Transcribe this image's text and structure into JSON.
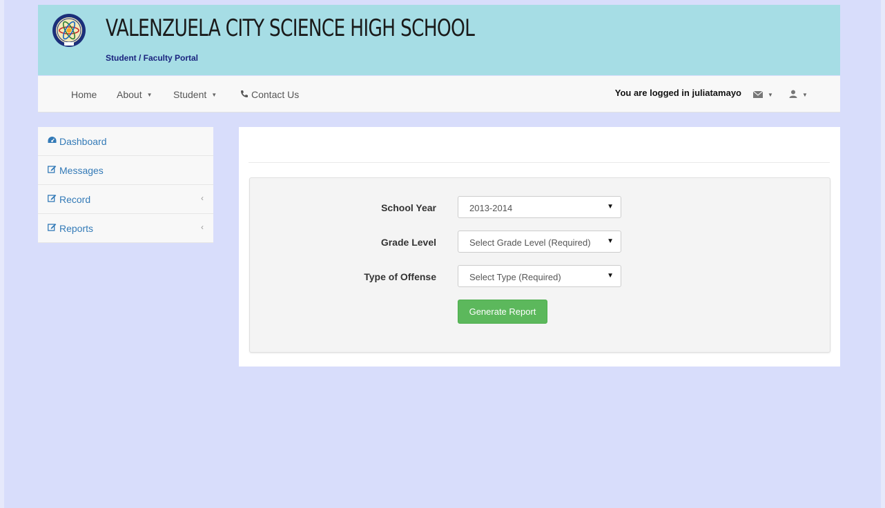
{
  "header": {
    "school_name": "VALENZUELA CITY SCIENCE HIGH SCHOOL",
    "subtitle": "Student / Faculty Portal",
    "logo_icon": "school-seal-icon"
  },
  "navbar": {
    "home": "Home",
    "about": "About",
    "student": "Student",
    "contact": "Contact Us",
    "logged_in_text": "You are logged in juliatamayo"
  },
  "sidebar": {
    "items": [
      {
        "label": "Dashboard",
        "icon": "dashboard-icon"
      },
      {
        "label": "Messages",
        "icon": "edit-icon"
      },
      {
        "label": "Record",
        "icon": "edit-icon"
      },
      {
        "label": "Reports",
        "icon": "edit-icon"
      }
    ]
  },
  "form": {
    "school_year_label": "School Year",
    "school_year_value": "2013-2014",
    "grade_level_label": "Grade Level",
    "grade_level_placeholder": "Select Grade Level (Required)",
    "offense_label": "Type of Offense",
    "offense_placeholder": "Select Type (Required)",
    "generate_button": "Generate Report"
  },
  "colors": {
    "banner": "#a6dde5",
    "page_bg": "#d8ddfb",
    "link": "#337ab7",
    "success": "#5cb85c"
  }
}
